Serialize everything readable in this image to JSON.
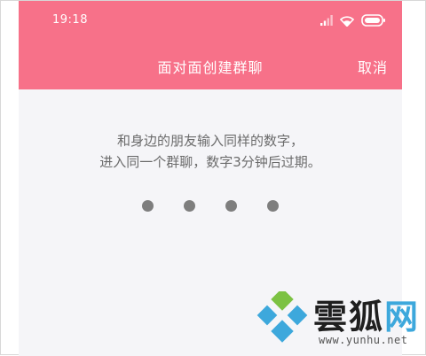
{
  "status_bar": {
    "time": "19:18",
    "icons": [
      "signal-icon",
      "wifi-icon",
      "battery-icon"
    ]
  },
  "nav": {
    "title": "面对面创建群聊",
    "cancel_label": "取消"
  },
  "instructions": {
    "line1": "和身边的朋友输入同样的数字，",
    "line2": "进入同一个群聊，数字3分钟后过期。"
  },
  "code_input": {
    "digits_entered": 0,
    "digit_count": 4
  },
  "watermark": {
    "brand_part1": "雲狐",
    "brand_part2": "网",
    "url": "www.yunhu.net"
  },
  "colors": {
    "header": "#f77189",
    "background": "#f5f5f8",
    "text": "#6b6b6b",
    "dot": "#7e7e7e"
  }
}
